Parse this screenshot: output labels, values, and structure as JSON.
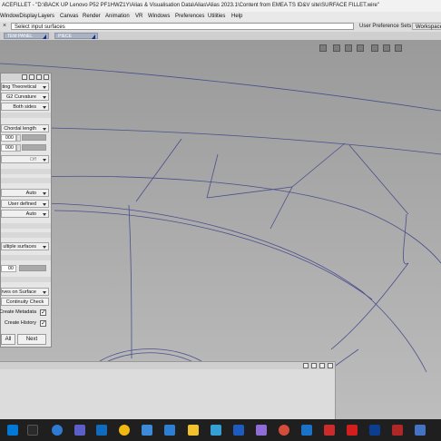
{
  "window": {
    "title": "ACEFILLET - \"D:\\BACK UP Lenovo P52 PF1HWZ1Y\\Alias & Visualisation Data\\Alias\\Alias 2023.1\\Content from EMEA TS ID&V site\\SURFACE FILLET.wire\""
  },
  "menu": {
    "items": [
      "WindowDisplay",
      "Layers",
      "Canvas",
      "Render",
      "Animation",
      "VR",
      "Windows",
      "Preferences",
      "Utilities",
      "Help"
    ]
  },
  "prompt": {
    "text": "Select input surfaces",
    "user_preference_sets": "User Preference Sets",
    "workspaces": "Workspaces"
  },
  "shelves": {
    "tabs": [
      "TEM PANEL",
      "PIECE"
    ]
  },
  "panel": {
    "rows": {
      "construction": "sting Theoretical",
      "continuity": "G2 Curvature",
      "sides": "Both sides",
      "section_type": "Chordal length",
      "value1": "000",
      "value2": "000",
      "off": "Off",
      "auto1": "Auto",
      "user_defined": "User defined",
      "auto2": "Auto",
      "multiple_surfaces": "ultiple surfaces",
      "value3": "00",
      "curves_on_surface": "rves on Surface",
      "continuity_check": "Continuity Check",
      "create_metadata": "Create Metadata",
      "create_history": "Create History"
    },
    "check_mark": "✓",
    "reset_all": "All",
    "next": "Next"
  },
  "colors": {
    "curve": "#4a4f8c",
    "panel_bg": "#e6e6e6",
    "taskbar": "#1f1f1f"
  }
}
